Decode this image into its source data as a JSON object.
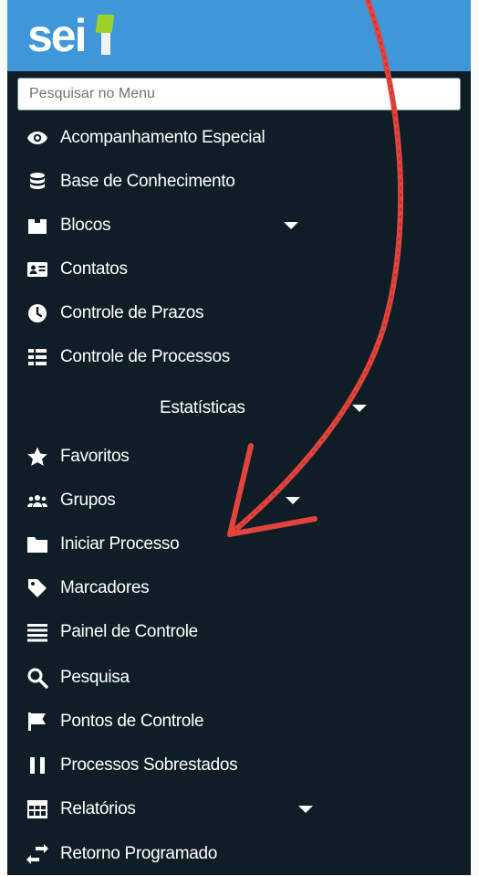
{
  "header": {
    "logo_text": "sei"
  },
  "search": {
    "placeholder": "Pesquisar no Menu"
  },
  "menu": {
    "items": [
      {
        "label": "Acompanhamento Especial"
      },
      {
        "label": "Base de Conhecimento"
      },
      {
        "label": "Blocos"
      },
      {
        "label": "Contatos"
      },
      {
        "label": "Controle de Prazos"
      },
      {
        "label": "Controle de Processos"
      },
      {
        "label": "Estatísticas"
      },
      {
        "label": "Favoritos"
      },
      {
        "label": "Grupos"
      },
      {
        "label": "Iniciar Processo"
      },
      {
        "label": "Marcadores"
      },
      {
        "label": "Painel de Controle"
      },
      {
        "label": "Pesquisa"
      },
      {
        "label": "Pontos de Controle"
      },
      {
        "label": "Processos Sobrestados"
      },
      {
        "label": "Relatórios"
      },
      {
        "label": "Retorno Programado"
      }
    ]
  },
  "colors": {
    "header": "#3f97d9",
    "sidebar": "#0f1d26",
    "logo_accent": "#9bd12b",
    "annotation_arrow": "#e2443d"
  }
}
